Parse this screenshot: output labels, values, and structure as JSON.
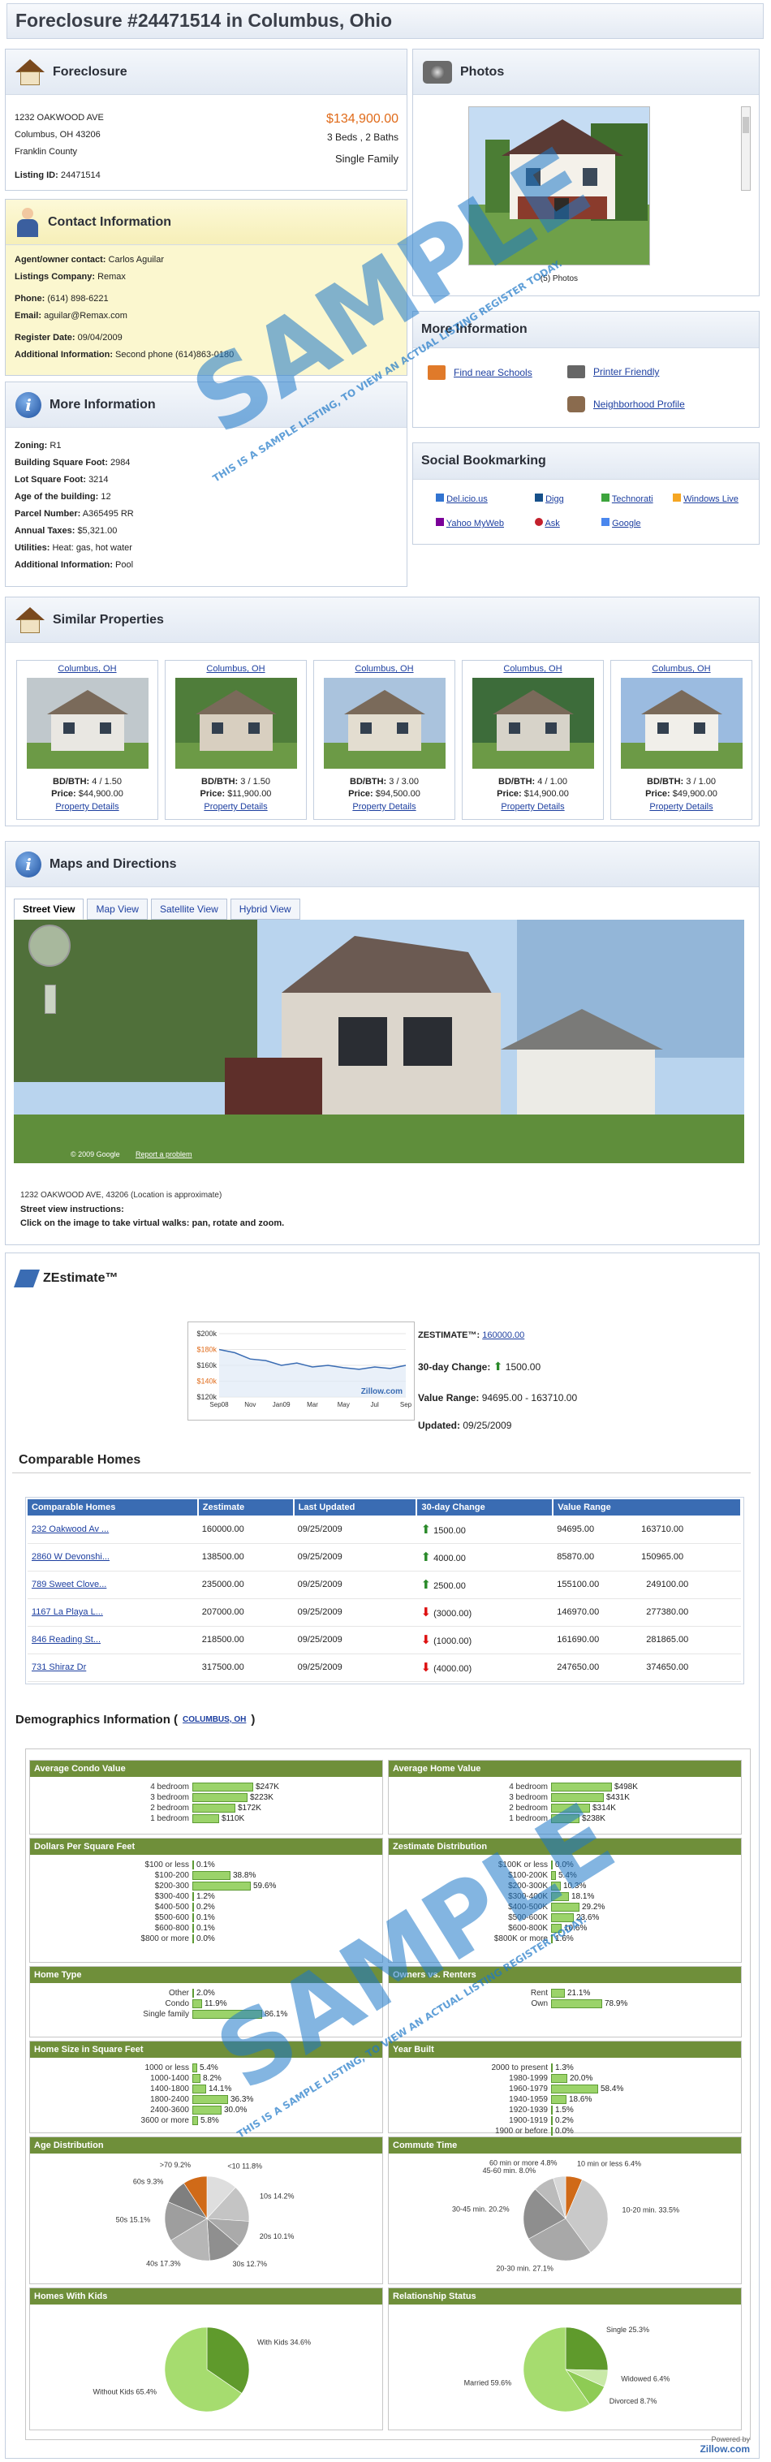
{
  "page": {
    "title": "Foreclosure #24471514 in Columbus, Ohio"
  },
  "foreclosure": {
    "heading": "Foreclosure",
    "address1": "1232 OAKWOOD AVE",
    "address2": "Columbus, OH 43206",
    "county": "Franklin County",
    "listing_label": "Listing ID:",
    "listing_id": "24471514",
    "price": "$134,900.00",
    "beds_baths": "3 Beds , 2 Baths",
    "type": "Single Family"
  },
  "contact": {
    "heading": "Contact Information",
    "rows": [
      {
        "k": "Agent/owner contact:",
        "v": "Carlos Aguilar"
      },
      {
        "k": "Listings Company:",
        "v": "Remax"
      },
      {
        "k": "Phone:",
        "v": "(614) 898-6221"
      },
      {
        "k": "Email:",
        "v": "aguilar@Remax.com"
      },
      {
        "k": "Register Date:",
        "v": "09/04/2009"
      },
      {
        "k": "Additional Information:",
        "v": "Second phone (614)863-0180"
      }
    ]
  },
  "more_info": {
    "heading": "More Information",
    "rows": [
      {
        "k": "Zoning:",
        "v": "R1"
      },
      {
        "k": "Building Square Foot:",
        "v": "2984"
      },
      {
        "k": "Lot Square Foot:",
        "v": "3214"
      },
      {
        "k": "Age of the building:",
        "v": "12"
      },
      {
        "k": "Parcel Number:",
        "v": "A365495 RR"
      },
      {
        "k": "Annual Taxes:",
        "v": "$5,321.00"
      },
      {
        "k": "Utilities:",
        "v": "Heat: gas, hot water"
      },
      {
        "k": "Additional Information:",
        "v": "Pool"
      }
    ]
  },
  "photos": {
    "heading": "Photos",
    "caption": "(5) Photos"
  },
  "more_links": {
    "heading": "More Information",
    "schools": "Find near Schools",
    "printer": "Printer Friendly",
    "neighborhood": "Neighborhood Profile"
  },
  "social": {
    "heading": "Social Bookmarking",
    "links": [
      "Del.icio.us",
      "Digg",
      "Technorati",
      "Windows Live",
      "Yahoo MyWeb",
      "Ask",
      "Google"
    ]
  },
  "similar": {
    "heading": "Similar Properties",
    "props": [
      {
        "city": "Columbus, OH",
        "bdbth": "4 / 1.50",
        "price": "$44,900.00",
        "link": "Property Details"
      },
      {
        "city": "Columbus, OH",
        "bdbth": "3 / 1.50",
        "price": "$11,900.00",
        "link": "Property Details"
      },
      {
        "city": "Columbus, OH",
        "bdbth": "3 / 3.00",
        "price": "$94,500.00",
        "link": "Property Details"
      },
      {
        "city": "Columbus, OH",
        "bdbth": "4 / 1.00",
        "price": "$14,900.00",
        "link": "Property Details"
      },
      {
        "city": "Columbus, OH",
        "bdbth": "3 / 1.00",
        "price": "$49,900.00",
        "link": "Property Details"
      }
    ],
    "bdbth_label": "BD/BTH:",
    "price_label": "Price:"
  },
  "maps": {
    "heading": "Maps and Directions",
    "tabs": [
      "Street View",
      "Map View",
      "Satellite View",
      "Hybrid View"
    ],
    "copyright": "© 2009 Google",
    "report": "Report a problem",
    "address_note": "1232 OAKWOOD AVE, 43206 (Location is approximate)",
    "instr_title": "Street view instructions:",
    "instr": "Click on the image to take virtual walks: pan, rotate and zoom."
  },
  "zestimate": {
    "heading": "ZEstimate™",
    "zest_label": "ZESTIMATE™:",
    "zest_value": "160000.00",
    "change_label": "30-day Change:",
    "change_value": "1500.00",
    "range_label": "Value Range:",
    "range_value": "94695.00 - 163710.00",
    "updated_label": "Updated:",
    "updated_value": "09/25/2009",
    "chart_brand": "Zillow.com"
  },
  "chart_data": {
    "type": "line",
    "x": [
      "Sep08",
      "Nov",
      "Jan09",
      "Mar",
      "May",
      "Jul",
      "Sep"
    ],
    "values": [
      180,
      176,
      168,
      166,
      160,
      163,
      158,
      160,
      157,
      155,
      158,
      156,
      160
    ],
    "ylabels": [
      "$200k",
      "$180k",
      "$160k",
      "$140k",
      "$120k"
    ],
    "ylim": [
      120,
      200
    ]
  },
  "comparable": {
    "heading": "Comparable Homes",
    "columns": [
      "Comparable Homes",
      "Zestimate",
      "Last Updated",
      "30-day Change",
      "Value Range"
    ],
    "rows": [
      {
        "name": "232 Oakwood Av ...",
        "z": "160000.00",
        "u": "09/25/2009",
        "c": "1500.00",
        "dir": "up",
        "lo": "94695.00",
        "hi": "163710.00"
      },
      {
        "name": "2860 W Devonshi...",
        "z": "138500.00",
        "u": "09/25/2009",
        "c": "4000.00",
        "dir": "up",
        "lo": "85870.00",
        "hi": "150965.00"
      },
      {
        "name": "789 Sweet Clove...",
        "z": "235000.00",
        "u": "09/25/2009",
        "c": "2500.00",
        "dir": "up",
        "lo": "155100.00",
        "hi": "249100.00"
      },
      {
        "name": "1167 La Playa L...",
        "z": "207000.00",
        "u": "09/25/2009",
        "c": "(3000.00)",
        "dir": "down",
        "lo": "146970.00",
        "hi": "277380.00"
      },
      {
        "name": "846 Reading St...",
        "z": "218500.00",
        "u": "09/25/2009",
        "c": "(1000.00)",
        "dir": "down",
        "lo": "161690.00",
        "hi": "281865.00"
      },
      {
        "name": "731 Shiraz Dr",
        "z": "317500.00",
        "u": "09/25/2009",
        "c": "(4000.00)",
        "dir": "down",
        "lo": "247650.00",
        "hi": "374650.00"
      }
    ]
  },
  "demographics": {
    "heading": "Demographics Information (",
    "link": "COLUMBUS, OH",
    "close": ")",
    "condo": {
      "title": "Average Condo Value",
      "rows": [
        {
          "l": "4 bedroom",
          "v": "$247K",
          "p": 0.3
        },
        {
          "l": "3 bedroom",
          "v": "$223K",
          "p": 0.27
        },
        {
          "l": "2 bedroom",
          "v": "$172K",
          "p": 0.21
        },
        {
          "l": "1 bedroom",
          "v": "$110K",
          "p": 0.13
        }
      ]
    },
    "home": {
      "title": "Average Home Value",
      "rows": [
        {
          "l": "4 bedroom",
          "v": "$498K",
          "p": 0.3
        },
        {
          "l": "3 bedroom",
          "v": "$431K",
          "p": 0.26
        },
        {
          "l": "2 bedroom",
          "v": "$314K",
          "p": 0.19
        },
        {
          "l": "1 bedroom",
          "v": "$238K",
          "p": 0.14
        }
      ]
    },
    "dpsf": {
      "title": "Dollars Per Square Feet",
      "rows": [
        {
          "l": "$100 or less",
          "v": "0.1%",
          "p": 0.001
        },
        {
          "l": "$100-200",
          "v": "38.8%",
          "p": 0.39
        },
        {
          "l": "$200-300",
          "v": "59.6%",
          "p": 0.596
        },
        {
          "l": "$300-400",
          "v": "1.2%",
          "p": 0.012
        },
        {
          "l": "$400-500",
          "v": "0.2%",
          "p": 0.002
        },
        {
          "l": "$500-600",
          "v": "0.1%",
          "p": 0.001
        },
        {
          "l": "$600-800",
          "v": "0.1%",
          "p": 0.001
        },
        {
          "l": "$800 or more",
          "v": "0.0%",
          "p": 0
        }
      ]
    },
    "zdist": {
      "title": "Zestimate Distribution",
      "rows": [
        {
          "l": "$100K or less",
          "v": "0.0%",
          "p": 0
        },
        {
          "l": "$100-200K",
          "v": "5.4%",
          "p": 0.054
        },
        {
          "l": "$200-300K",
          "v": "10.3%",
          "p": 0.103
        },
        {
          "l": "$300-400K",
          "v": "18.1%",
          "p": 0.181
        },
        {
          "l": "$400-500K",
          "v": "29.2%",
          "p": 0.292
        },
        {
          "l": "$500-600K",
          "v": "23.6%",
          "p": 0.236
        },
        {
          "l": "$600-800K",
          "v": "10.6%",
          "p": 0.106
        },
        {
          "l": "$800K or more",
          "v": "1.6%",
          "p": 0.016
        }
      ]
    },
    "hometype": {
      "title": "Home Type",
      "rows": [
        {
          "l": "Other",
          "v": "2.0%",
          "p": 0.02
        },
        {
          "l": "Condo",
          "v": "11.9%",
          "p": 0.119
        },
        {
          "l": "Single family",
          "v": "86.1%",
          "p": 0.861
        }
      ]
    },
    "owners": {
      "title": "Owners vs. Renters",
      "rows": [
        {
          "l": "Rent",
          "v": "21.1%",
          "p": 0.211
        },
        {
          "l": "Own",
          "v": "78.9%",
          "p": 0.789
        }
      ]
    },
    "homesize": {
      "title": "Home Size in Square Feet",
      "rows": [
        {
          "l": "1000 or less",
          "v": "5.4%",
          "p": 0.054
        },
        {
          "l": "1000-1400",
          "v": "8.2%",
          "p": 0.082
        },
        {
          "l": "1400-1800",
          "v": "14.1%",
          "p": 0.141
        },
        {
          "l": "1800-2400",
          "v": "36.3%",
          "p": 0.363
        },
        {
          "l": "2400-3600",
          "v": "30.0%",
          "p": 0.3
        },
        {
          "l": "3600 or more",
          "v": "5.8%",
          "p": 0.058
        }
      ]
    },
    "yearbuilt": {
      "title": "Year Built",
      "rows": [
        {
          "l": "2000 to present",
          "v": "1.3%",
          "p": 0.013
        },
        {
          "l": "1980-1999",
          "v": "20.0%",
          "p": 0.2
        },
        {
          "l": "1960-1979",
          "v": "58.4%",
          "p": 0.584
        },
        {
          "l": "1940-1959",
          "v": "18.6%",
          "p": 0.186
        },
        {
          "l": "1920-1939",
          "v": "1.5%",
          "p": 0.015
        },
        {
          "l": "1900-1919",
          "v": "0.2%",
          "p": 0.002
        },
        {
          "l": "1900 or before",
          "v": "0.0%",
          "p": 0
        }
      ]
    },
    "age": {
      "title": "Age Distribution",
      "slices": [
        {
          "l": "<10",
          "v": "11.8%",
          "p": 11.8
        },
        {
          "l": "10s",
          "v": "14.2%",
          "p": 14.2
        },
        {
          "l": "20s",
          "v": "10.1%",
          "p": 10.1
        },
        {
          "l": "30s",
          "v": "12.7%",
          "p": 12.7
        },
        {
          "l": "40s",
          "v": "17.3%",
          "p": 17.3
        },
        {
          "l": "50s",
          "v": "15.1%",
          "p": 15.1
        },
        {
          "l": "60s",
          "v": "9.3%",
          "p": 9.3
        },
        {
          "l": ">70",
          "v": "9.2%",
          "p": 9.2
        }
      ]
    },
    "commute": {
      "title": "Commute Time",
      "slices": [
        {
          "l": "10 min or less",
          "v": "6.4%",
          "p": 6.4
        },
        {
          "l": "10-20 min.",
          "v": "33.5%",
          "p": 33.5
        },
        {
          "l": "20-30 min.",
          "v": "27.1%",
          "p": 27.1
        },
        {
          "l": "30-45 min.",
          "v": "20.2%",
          "p": 20.2
        },
        {
          "l": "45-60 min.",
          "v": "8.0%",
          "p": 8.0
        },
        {
          "l": "60 min or more",
          "v": "4.8%",
          "p": 4.8
        }
      ]
    },
    "kids": {
      "title": "Homes With Kids",
      "slices": [
        {
          "l": "With Kids",
          "v": "34.6%",
          "p": 34.6
        },
        {
          "l": "Without Kids",
          "v": "65.4%",
          "p": 65.4
        }
      ]
    },
    "relationship": {
      "title": "Relationship Status",
      "slices": [
        {
          "l": "Single",
          "v": "25.3%",
          "p": 25.3
        },
        {
          "l": "Widowed",
          "v": "6.4%",
          "p": 6.4
        },
        {
          "l": "Divorced",
          "v": "8.7%",
          "p": 8.7
        },
        {
          "l": "Married",
          "v": "59.6%",
          "p": 59.6
        }
      ]
    }
  },
  "footer": {
    "powered": "Powered by",
    "brand": "Zillow.com"
  },
  "watermark": {
    "big": "SAMPLE",
    "small": "THIS IS A SAMPLE LISTING, TO VIEW AN ACTUAL LISTING REGISTER TODAY."
  },
  "colors": {
    "accent": "#3a6cb3",
    "price": "#e06b1a",
    "demo_header": "#6f8f3a",
    "bar": "#9bd36a"
  }
}
